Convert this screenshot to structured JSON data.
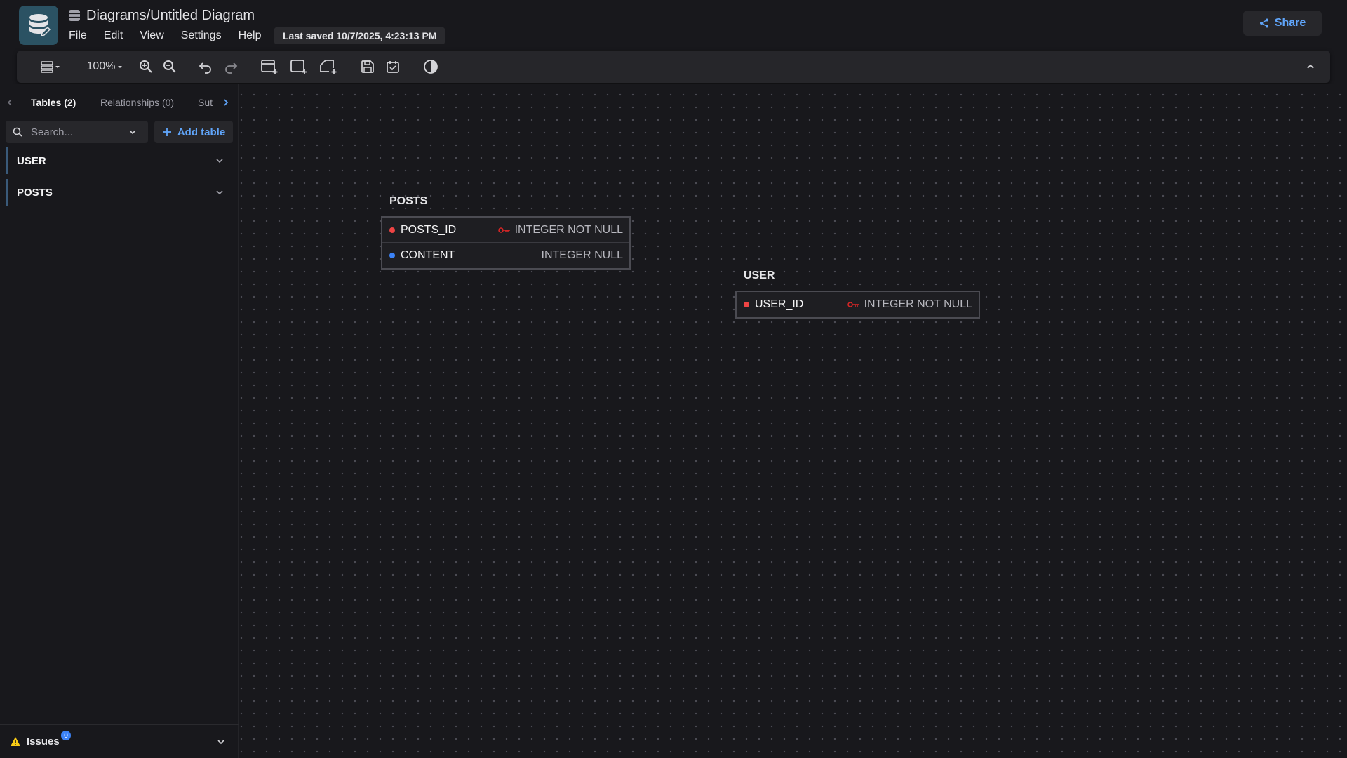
{
  "header": {
    "title": "Diagrams/Untitled Diagram",
    "menu": [
      "File",
      "Edit",
      "View",
      "Settings",
      "Help"
    ],
    "last_saved": "Last saved 10/7/2025, 4:23:13 PM",
    "share_label": "Share"
  },
  "toolbar": {
    "zoom": "100%"
  },
  "sidebar": {
    "tabs": [
      {
        "label": "Tables (2)",
        "active": true
      },
      {
        "label": "Relationships (0)"
      },
      {
        "label": "Sut"
      }
    ],
    "search_placeholder": "Search...",
    "add_table_label": "Add table",
    "tables": [
      {
        "name": "USER"
      },
      {
        "name": "POSTS"
      }
    ],
    "issues_label": "Issues",
    "issues_count": "0"
  },
  "canvas": {
    "tables": [
      {
        "name": "POSTS",
        "columns": [
          {
            "name": "POSTS_ID",
            "type": "INTEGER NOT NULL",
            "primary_key": true,
            "dot_color": "#ef4444"
          },
          {
            "name": "CONTENT",
            "type": "INTEGER NULL",
            "primary_key": false,
            "dot_color": "#3b82f6"
          }
        ]
      },
      {
        "name": "USER",
        "columns": [
          {
            "name": "USER_ID",
            "type": "INTEGER NOT NULL",
            "primary_key": true,
            "dot_color": "#ef4444"
          }
        ]
      }
    ]
  },
  "colors": {
    "accent": "#60a5fa",
    "logo_bg": "#2b5263",
    "pk_color": "#ef4444",
    "warning": "#facc15"
  }
}
